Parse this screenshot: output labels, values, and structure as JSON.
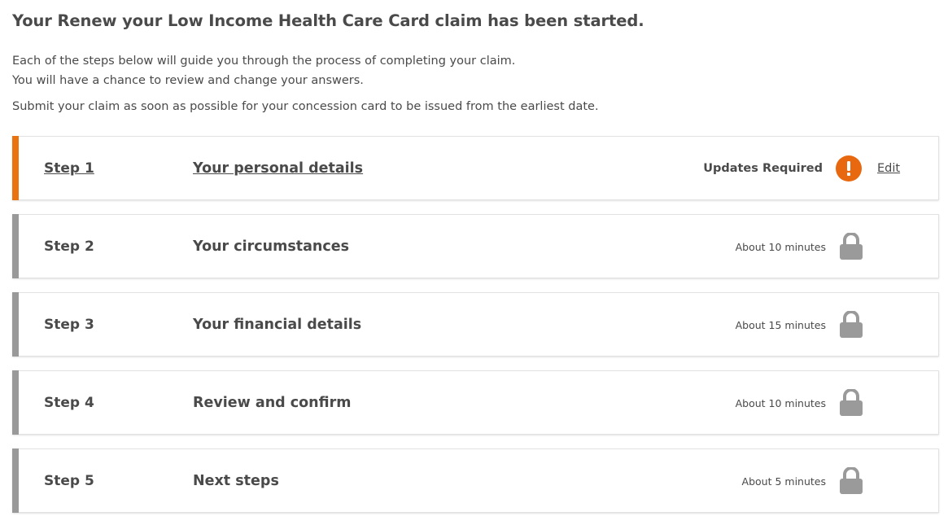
{
  "heading": "Your Renew your Low Income Health Care Card claim has been started.",
  "intro": {
    "line1": "Each of the steps below will guide you through the process of completing your claim.",
    "line2": "You will have a chance to review and change your answers.",
    "line3": "Submit your claim as soon as possible for your concession card to be issued from the earliest date."
  },
  "colors": {
    "active_accent": "#e8730f",
    "locked_accent": "#999999",
    "alert": "#e8680f",
    "lock_icon": "#9a9a9a"
  },
  "steps": [
    {
      "number": "Step 1",
      "title": "Your personal details",
      "status": "Updates Required",
      "status_icon": "exclamation-icon",
      "action": "Edit"
    },
    {
      "number": "Step 2",
      "title": "Your circumstances",
      "duration": "About 10 minutes",
      "status_icon": "lock-icon"
    },
    {
      "number": "Step 3",
      "title": "Your financial details",
      "duration": "About 15 minutes",
      "status_icon": "lock-icon"
    },
    {
      "number": "Step 4",
      "title": "Review and confirm",
      "duration": "About 10 minutes",
      "status_icon": "lock-icon"
    },
    {
      "number": "Step 5",
      "title": "Next steps",
      "duration": "About 5 minutes",
      "status_icon": "lock-icon"
    }
  ]
}
